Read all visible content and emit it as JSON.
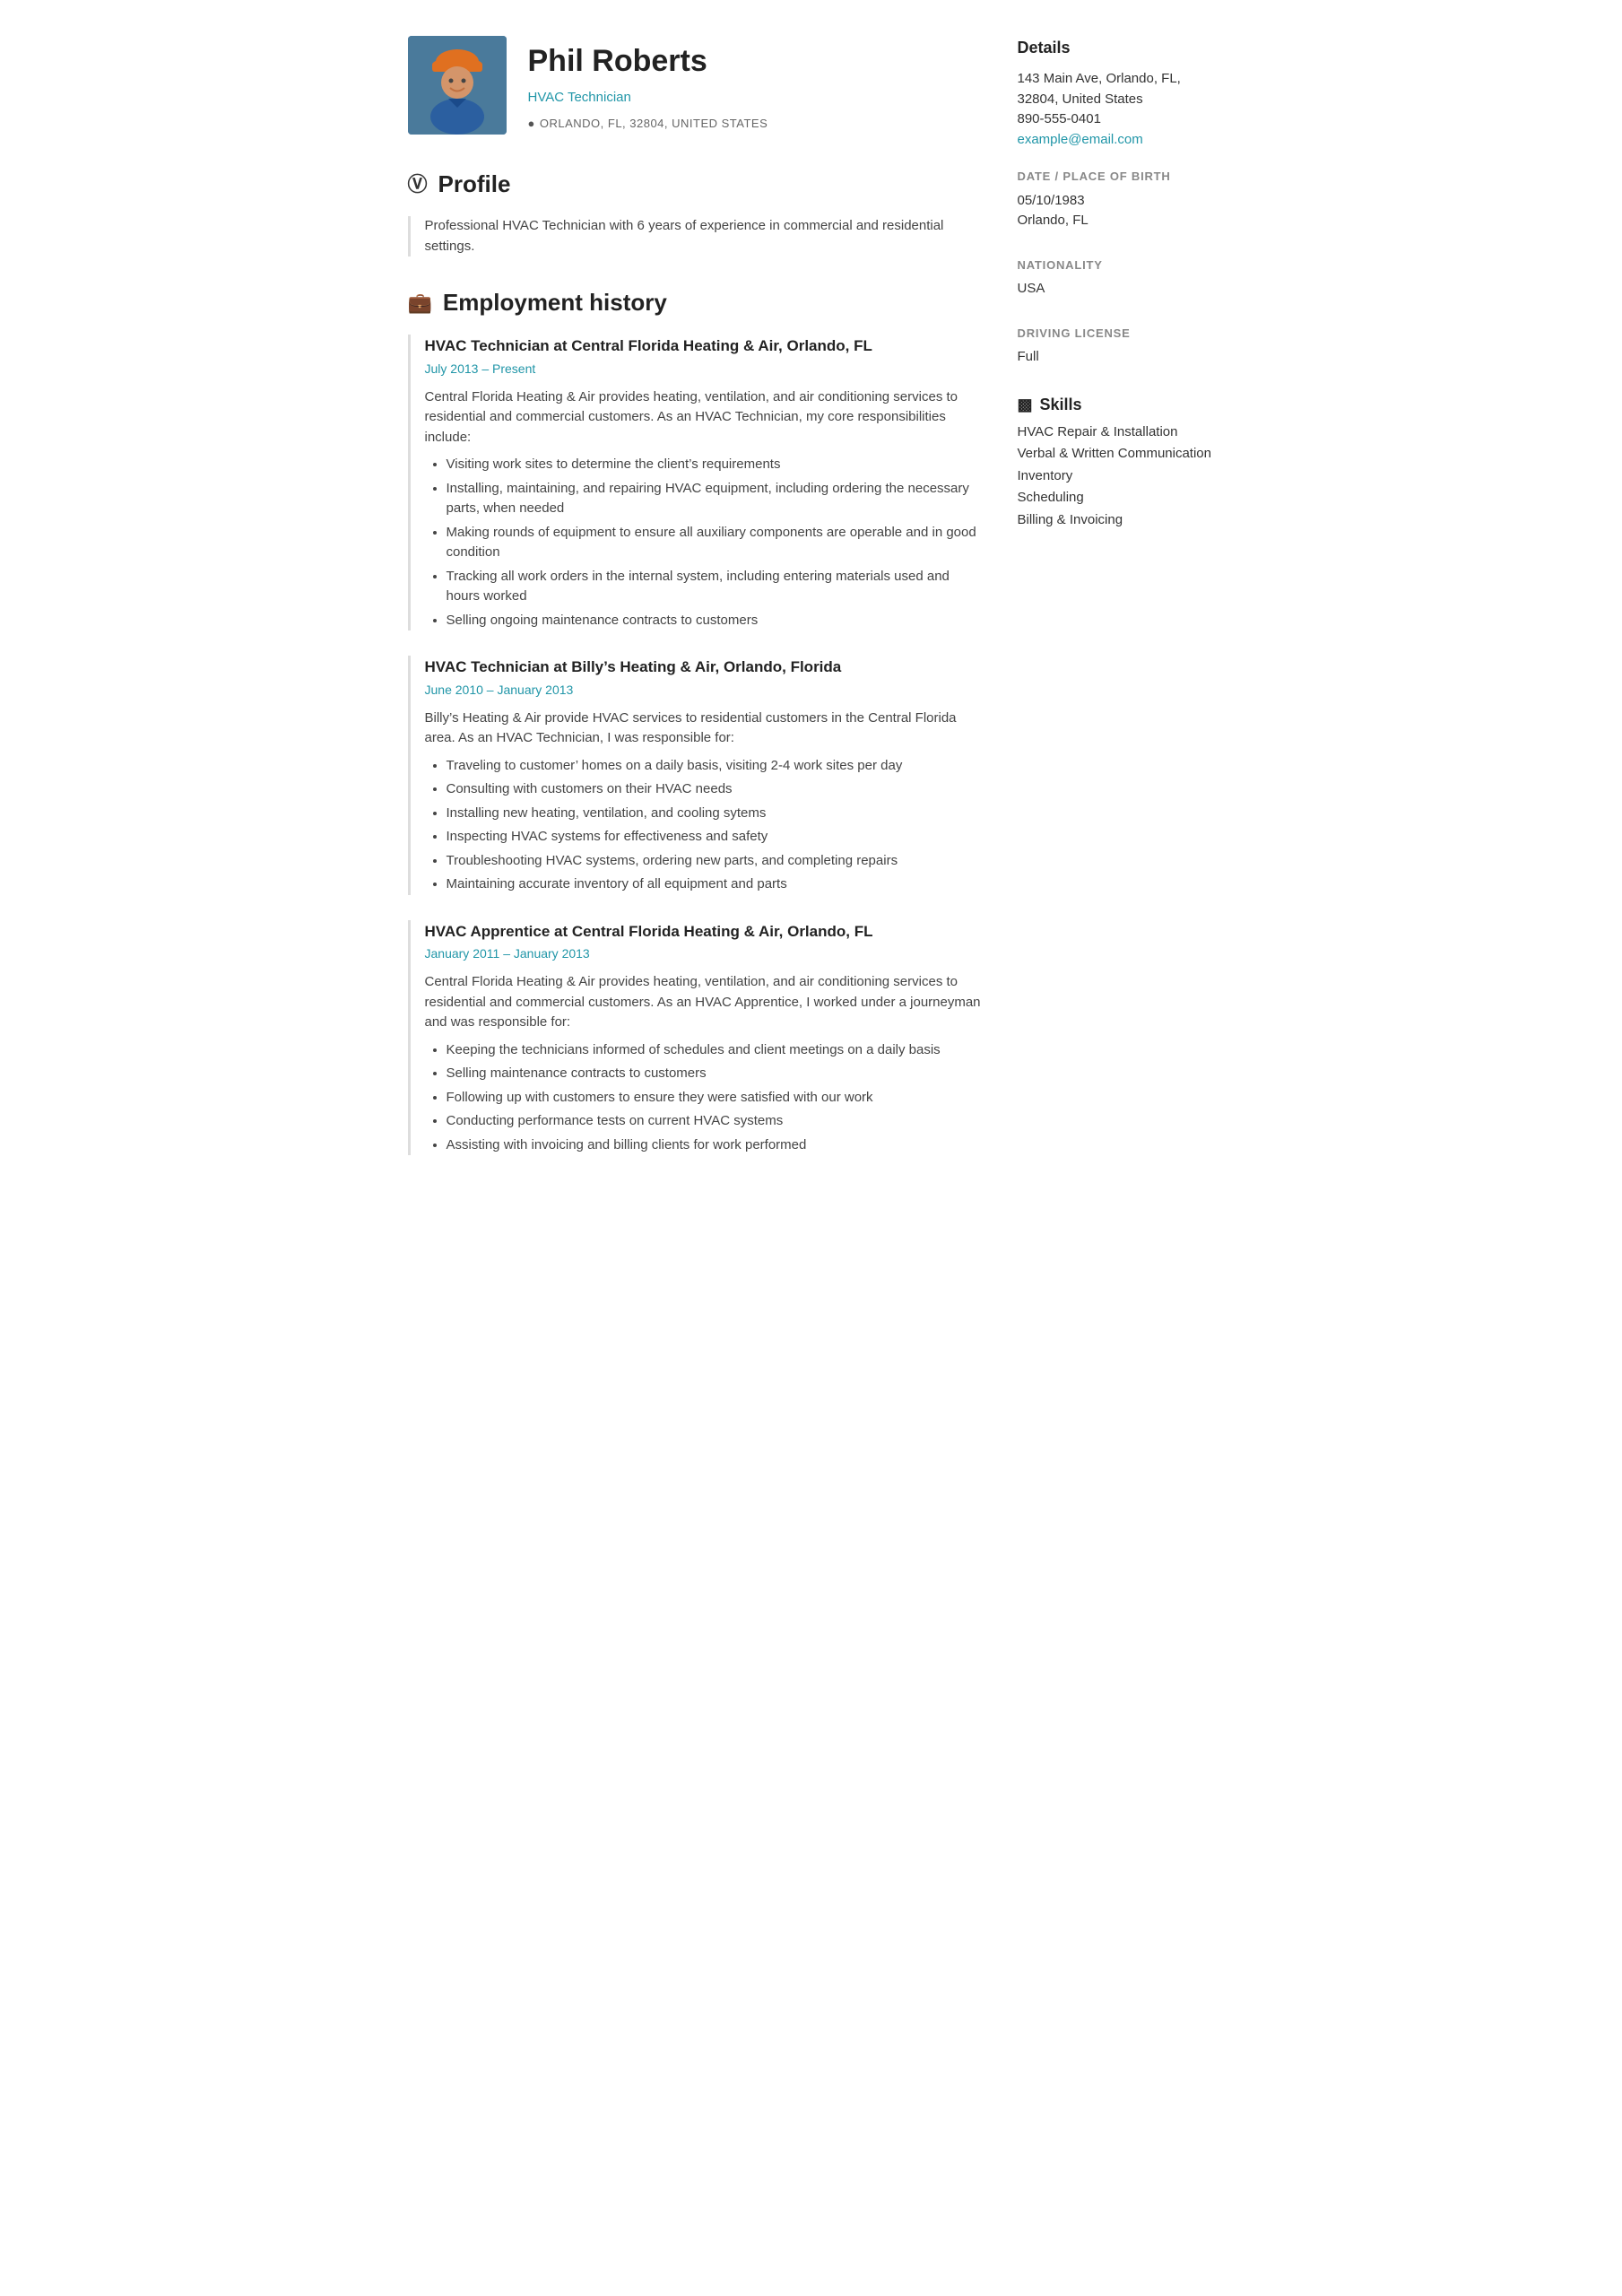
{
  "header": {
    "name": "Phil Roberts",
    "title": "HVAC Technician",
    "location": "ORLANDO, FL, 32804, UNITED STATES"
  },
  "profile": {
    "section_title": "Profile",
    "text": "Professional HVAC Technician with 6 years of experience in commercial and residential settings."
  },
  "employment": {
    "section_title": "Employment history",
    "jobs": [
      {
        "title": "HVAC Technician at Central Florida Heating & Air, Orlando, FL",
        "dates": "July 2013 – Present",
        "description": "Central Florida Heating & Air provides heating, ventilation, and air conditioning services to residential and commercial customers. As an HVAC Technician, my core responsibilities include:",
        "bullets": [
          "Visiting work sites to determine the client’s requirements",
          "Installing, maintaining, and repairing HVAC equipment, including ordering the necessary parts, when needed",
          "Making rounds of equipment to ensure all auxiliary components are operable and in good condition",
          "Tracking all work orders in the internal system, including entering materials used and hours worked",
          "Selling ongoing maintenance contracts to customers"
        ]
      },
      {
        "title": "HVAC Technician at Billy’s Heating & Air, Orlando, Florida",
        "dates": "June 2010 – January 2013",
        "description": "Billy’s Heating & Air provide HVAC services to residential customers in the Central Florida area. As an HVAC Technician, I was responsible for:",
        "bullets": [
          "Traveling to customer’ homes on a daily basis, visiting 2-4 work sites per day",
          "Consulting with customers on their HVAC needs",
          "Installing new heating, ventilation, and cooling sytems",
          "Inspecting HVAC systems for effectiveness and safety",
          "Troubleshooting HVAC systems, ordering new parts, and completing repairs",
          "Maintaining accurate inventory of all equipment and parts"
        ]
      },
      {
        "title": "HVAC Apprentice at Central Florida Heating & Air, Orlando, FL",
        "dates": "January 2011 – January 2013",
        "description": "Central Florida Heating & Air provides heating, ventilation, and air conditioning services to residential and commercial customers. As an HVAC Apprentice, I worked under a journeyman and was responsible for:",
        "bullets": [
          "Keeping the technicians informed of schedules and client meetings on a daily basis",
          "Selling maintenance contracts to customers",
          "Following up with customers to ensure they were satisfied with our work",
          "Conducting performance tests on current HVAC systems",
          "Assisting with invoicing and billing clients for work performed"
        ]
      }
    ]
  },
  "sidebar": {
    "details_title": "Details",
    "address": "143 Main Ave, Orlando, FL, 32804, United States",
    "phone": "890-555-0401",
    "email": "example@email.com",
    "dob_label": "DATE / PLACE OF BIRTH",
    "dob": "05/10/1983",
    "dob_place": "Orlando, FL",
    "nationality_label": "NATIONALITY",
    "nationality": "USA",
    "driving_label": "DRIVING LICENSE",
    "driving": "Full",
    "skills_title": "Skills",
    "skills": [
      "HVAC Repair & Installation",
      "Verbal & Written Communication",
      "Inventory",
      "Scheduling",
      "Billing & Invoicing"
    ]
  }
}
